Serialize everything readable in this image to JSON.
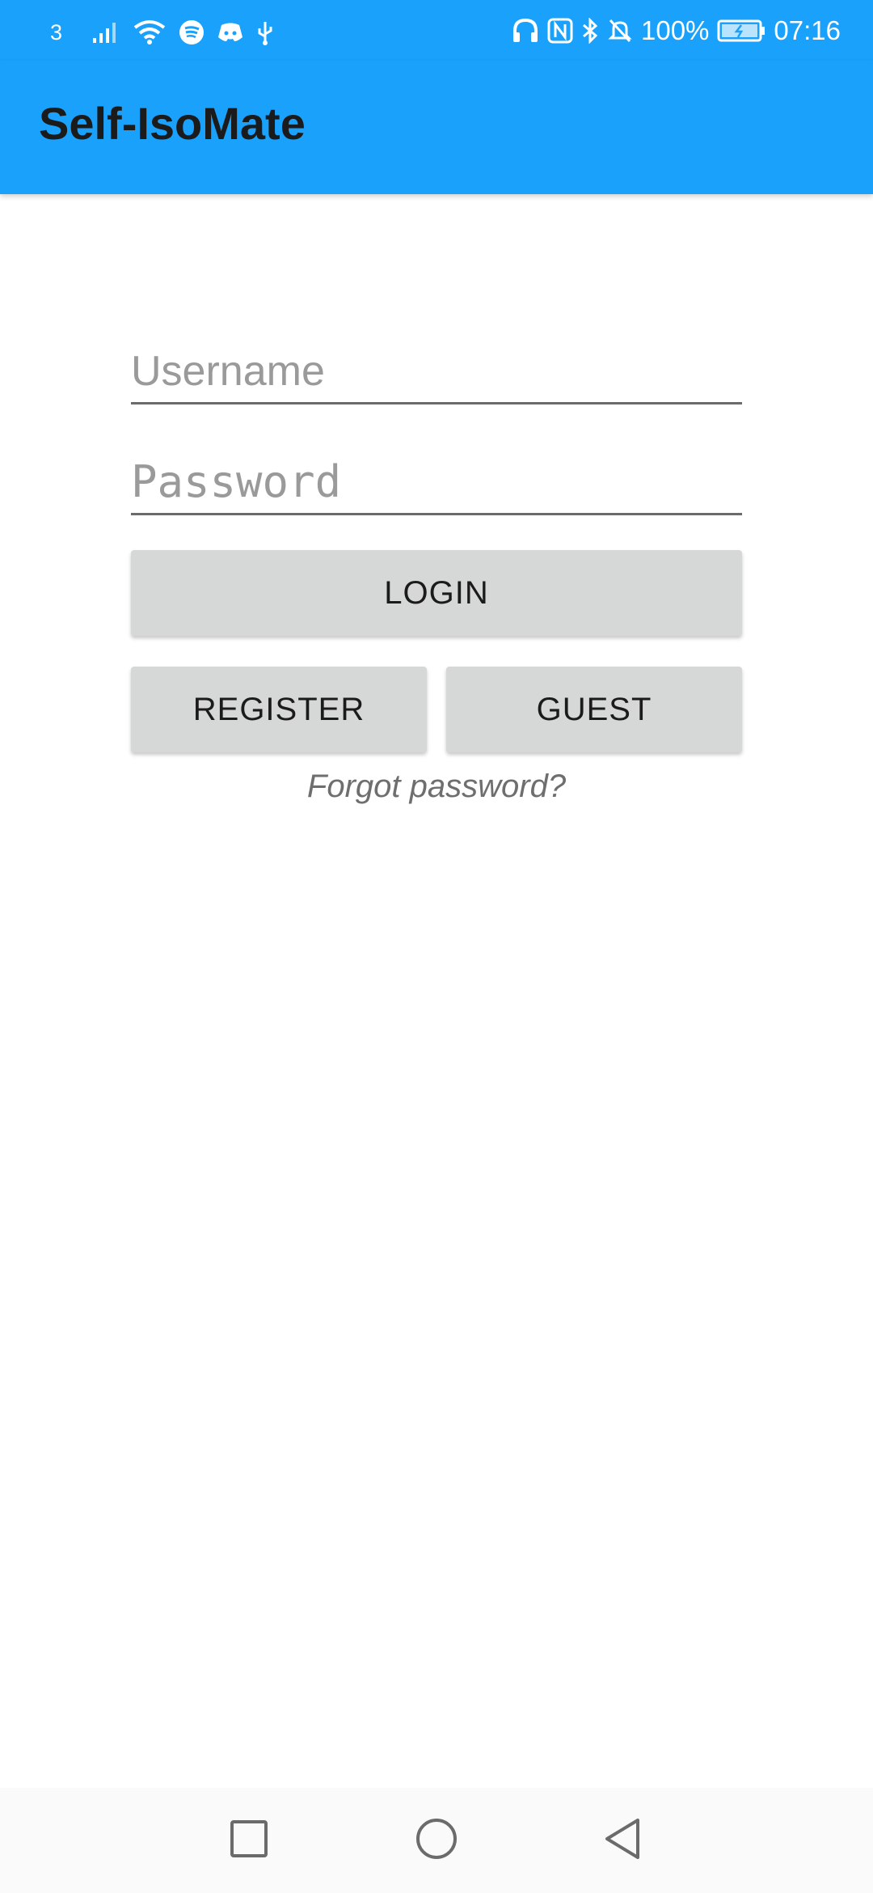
{
  "status_bar": {
    "carrier": "3",
    "battery_percent": "100%",
    "time": "07:16",
    "icons_left": [
      "signal-icon",
      "wifi-icon",
      "spotify-icon",
      "discord-icon",
      "usb-icon"
    ],
    "icons_right": [
      "headphones-icon",
      "nfc-icon",
      "bluetooth-icon",
      "mute-bell-icon",
      "battery-icon"
    ]
  },
  "toolbar": {
    "title": "Self-IsoMate",
    "background_color": "#1aa1fb"
  },
  "login_form": {
    "username_placeholder": "Username",
    "username_value": "",
    "password_placeholder": "Password",
    "password_value": "",
    "login_label": "LOGIN",
    "register_label": "REGISTER",
    "guest_label": "GUEST",
    "forgot_label": "Forgot password?"
  },
  "nav_bar": {
    "buttons": [
      "recent-apps-icon",
      "home-icon",
      "back-icon"
    ]
  }
}
